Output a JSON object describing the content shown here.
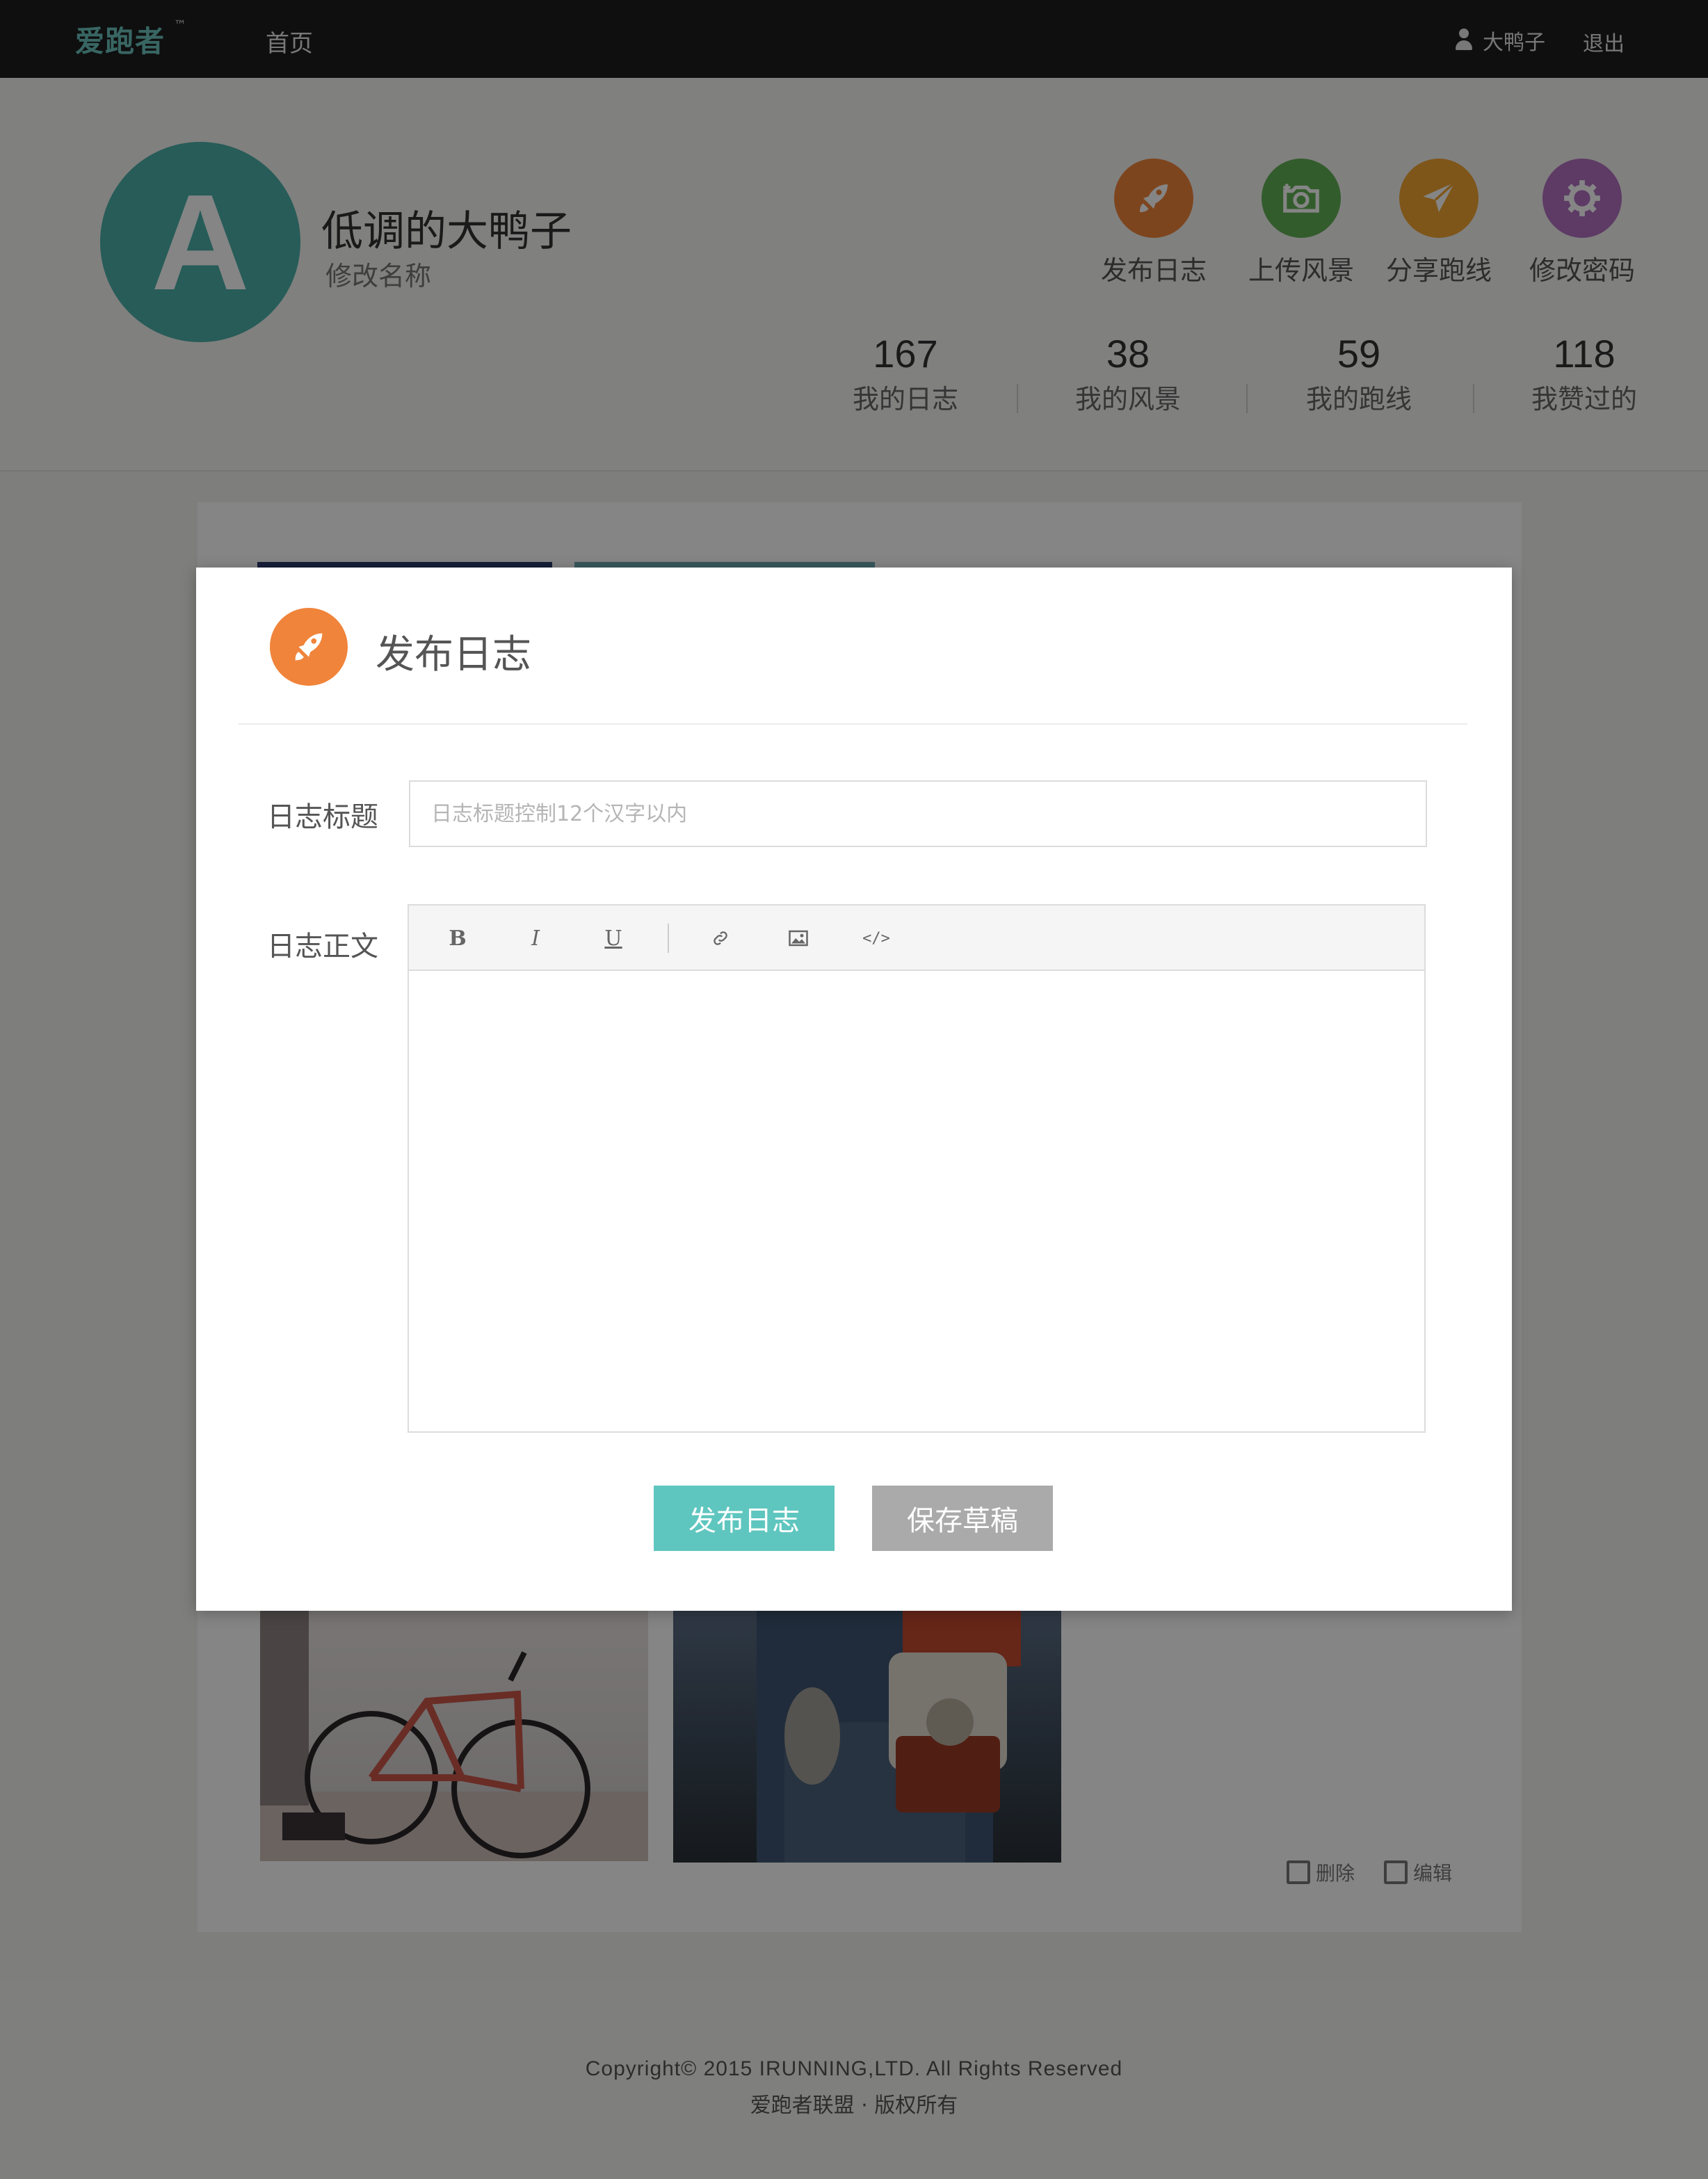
{
  "header": {
    "logo": "爱跑者",
    "logo_tm": "™",
    "nav_home": "首页",
    "user_name": "大鸭子",
    "logout": "退出"
  },
  "profile": {
    "avatar_letter": "A",
    "nickname": "低调的大鸭子",
    "rename_link": "修改名称",
    "actions": [
      {
        "label": "发布日志",
        "icon": "rocket-icon",
        "color": "#f0843a"
      },
      {
        "label": "上传风景",
        "icon": "camera-icon",
        "color": "#62b155"
      },
      {
        "label": "分享跑线",
        "icon": "paper-plane-icon",
        "color": "#f2a533"
      },
      {
        "label": "修改密码",
        "icon": "gear-icon",
        "color": "#b271c2"
      }
    ],
    "stats": [
      {
        "value": "167",
        "label": "我的日志"
      },
      {
        "value": "38",
        "label": "我的风景"
      },
      {
        "value": "59",
        "label": "我的跑线"
      },
      {
        "value": "118",
        "label": "我赞过的"
      }
    ]
  },
  "entry_actions": {
    "delete": "删除",
    "edit": "编辑"
  },
  "footer": {
    "copyright": "Copyright© 2015 IRUNNING,LTD. All Rights Reserved",
    "line2": "爱跑者联盟 · 版权所有"
  },
  "modal": {
    "title": "发布日志",
    "icon": "rocket-icon",
    "icon_color": "#f0843a",
    "title_label": "日志标题",
    "title_placeholder": "日志标题控制12个汉字以内",
    "title_value": "",
    "body_label": "日志正文",
    "toolbar": {
      "bold": "B",
      "italic": "I",
      "underline": "U",
      "link_icon": "link-icon",
      "image_icon": "image-icon",
      "code_icon": "code-icon",
      "code_glyph": "</>"
    },
    "publish_button": "发布日志",
    "draft_button": "保存草稿",
    "publish_color": "#5fc6bf",
    "draft_color": "#aaaaaa"
  }
}
